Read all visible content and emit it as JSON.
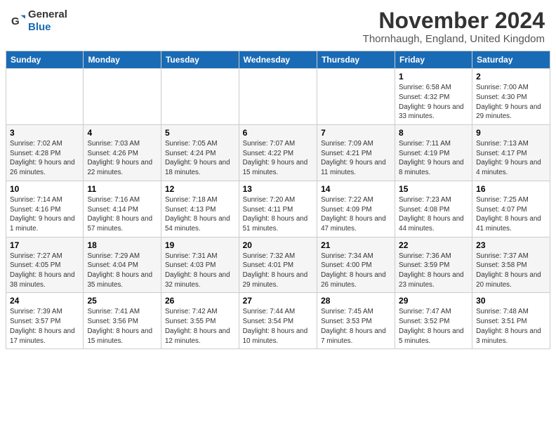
{
  "header": {
    "logo_general": "General",
    "logo_blue": "Blue",
    "title": "November 2024",
    "subtitle": "Thornhaugh, England, United Kingdom"
  },
  "calendar": {
    "days_of_week": [
      "Sunday",
      "Monday",
      "Tuesday",
      "Wednesday",
      "Thursday",
      "Friday",
      "Saturday"
    ],
    "weeks": [
      [
        {
          "day": "",
          "info": ""
        },
        {
          "day": "",
          "info": ""
        },
        {
          "day": "",
          "info": ""
        },
        {
          "day": "",
          "info": ""
        },
        {
          "day": "",
          "info": ""
        },
        {
          "day": "1",
          "info": "Sunrise: 6:58 AM\nSunset: 4:32 PM\nDaylight: 9 hours and 33 minutes."
        },
        {
          "day": "2",
          "info": "Sunrise: 7:00 AM\nSunset: 4:30 PM\nDaylight: 9 hours and 29 minutes."
        }
      ],
      [
        {
          "day": "3",
          "info": "Sunrise: 7:02 AM\nSunset: 4:28 PM\nDaylight: 9 hours and 26 minutes."
        },
        {
          "day": "4",
          "info": "Sunrise: 7:03 AM\nSunset: 4:26 PM\nDaylight: 9 hours and 22 minutes."
        },
        {
          "day": "5",
          "info": "Sunrise: 7:05 AM\nSunset: 4:24 PM\nDaylight: 9 hours and 18 minutes."
        },
        {
          "day": "6",
          "info": "Sunrise: 7:07 AM\nSunset: 4:22 PM\nDaylight: 9 hours and 15 minutes."
        },
        {
          "day": "7",
          "info": "Sunrise: 7:09 AM\nSunset: 4:21 PM\nDaylight: 9 hours and 11 minutes."
        },
        {
          "day": "8",
          "info": "Sunrise: 7:11 AM\nSunset: 4:19 PM\nDaylight: 9 hours and 8 minutes."
        },
        {
          "day": "9",
          "info": "Sunrise: 7:13 AM\nSunset: 4:17 PM\nDaylight: 9 hours and 4 minutes."
        }
      ],
      [
        {
          "day": "10",
          "info": "Sunrise: 7:14 AM\nSunset: 4:16 PM\nDaylight: 9 hours and 1 minute."
        },
        {
          "day": "11",
          "info": "Sunrise: 7:16 AM\nSunset: 4:14 PM\nDaylight: 8 hours and 57 minutes."
        },
        {
          "day": "12",
          "info": "Sunrise: 7:18 AM\nSunset: 4:13 PM\nDaylight: 8 hours and 54 minutes."
        },
        {
          "day": "13",
          "info": "Sunrise: 7:20 AM\nSunset: 4:11 PM\nDaylight: 8 hours and 51 minutes."
        },
        {
          "day": "14",
          "info": "Sunrise: 7:22 AM\nSunset: 4:09 PM\nDaylight: 8 hours and 47 minutes."
        },
        {
          "day": "15",
          "info": "Sunrise: 7:23 AM\nSunset: 4:08 PM\nDaylight: 8 hours and 44 minutes."
        },
        {
          "day": "16",
          "info": "Sunrise: 7:25 AM\nSunset: 4:07 PM\nDaylight: 8 hours and 41 minutes."
        }
      ],
      [
        {
          "day": "17",
          "info": "Sunrise: 7:27 AM\nSunset: 4:05 PM\nDaylight: 8 hours and 38 minutes."
        },
        {
          "day": "18",
          "info": "Sunrise: 7:29 AM\nSunset: 4:04 PM\nDaylight: 8 hours and 35 minutes."
        },
        {
          "day": "19",
          "info": "Sunrise: 7:31 AM\nSunset: 4:03 PM\nDaylight: 8 hours and 32 minutes."
        },
        {
          "day": "20",
          "info": "Sunrise: 7:32 AM\nSunset: 4:01 PM\nDaylight: 8 hours and 29 minutes."
        },
        {
          "day": "21",
          "info": "Sunrise: 7:34 AM\nSunset: 4:00 PM\nDaylight: 8 hours and 26 minutes."
        },
        {
          "day": "22",
          "info": "Sunrise: 7:36 AM\nSunset: 3:59 PM\nDaylight: 8 hours and 23 minutes."
        },
        {
          "day": "23",
          "info": "Sunrise: 7:37 AM\nSunset: 3:58 PM\nDaylight: 8 hours and 20 minutes."
        }
      ],
      [
        {
          "day": "24",
          "info": "Sunrise: 7:39 AM\nSunset: 3:57 PM\nDaylight: 8 hours and 17 minutes."
        },
        {
          "day": "25",
          "info": "Sunrise: 7:41 AM\nSunset: 3:56 PM\nDaylight: 8 hours and 15 minutes."
        },
        {
          "day": "26",
          "info": "Sunrise: 7:42 AM\nSunset: 3:55 PM\nDaylight: 8 hours and 12 minutes."
        },
        {
          "day": "27",
          "info": "Sunrise: 7:44 AM\nSunset: 3:54 PM\nDaylight: 8 hours and 10 minutes."
        },
        {
          "day": "28",
          "info": "Sunrise: 7:45 AM\nSunset: 3:53 PM\nDaylight: 8 hours and 7 minutes."
        },
        {
          "day": "29",
          "info": "Sunrise: 7:47 AM\nSunset: 3:52 PM\nDaylight: 8 hours and 5 minutes."
        },
        {
          "day": "30",
          "info": "Sunrise: 7:48 AM\nSunset: 3:51 PM\nDaylight: 8 hours and 3 minutes."
        }
      ]
    ]
  }
}
